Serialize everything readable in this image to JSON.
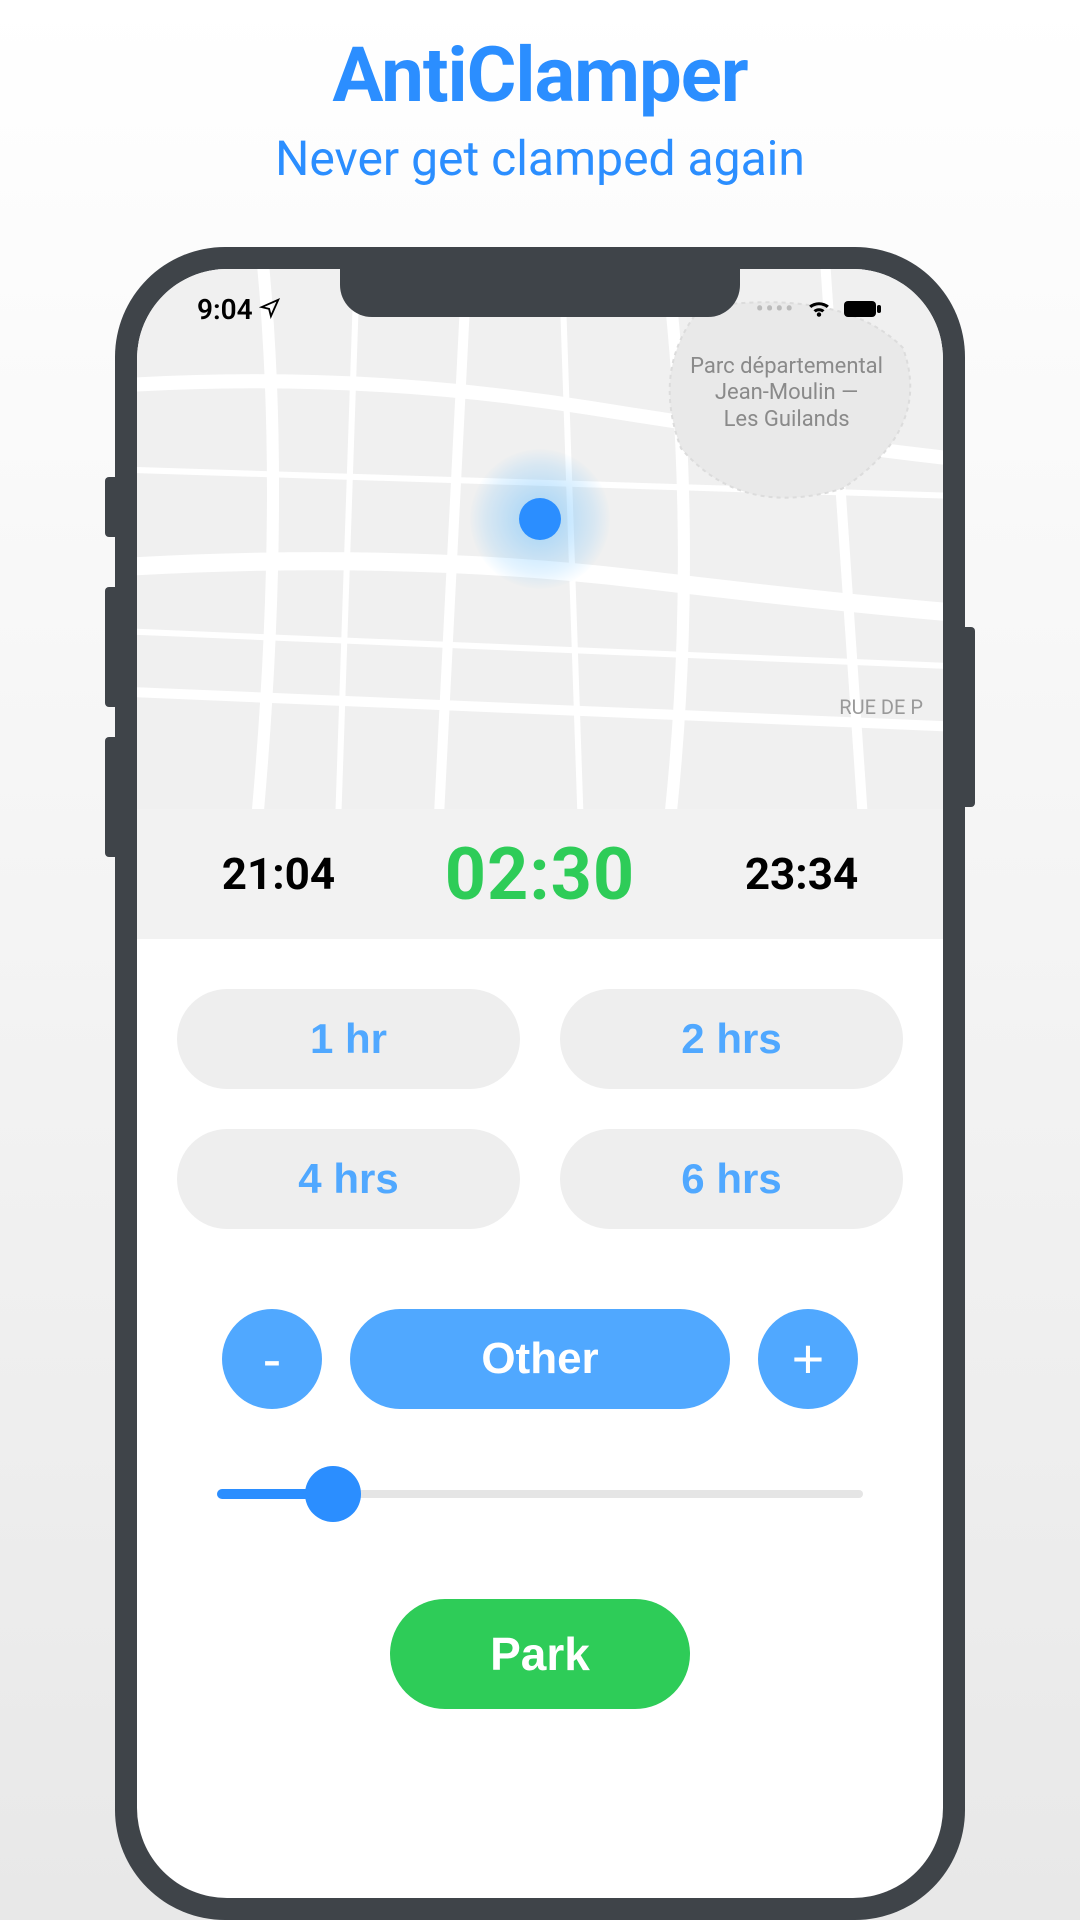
{
  "header": {
    "title": "AntiClamper",
    "subtitle": "Never get clamped again"
  },
  "status": {
    "time": "9:04",
    "location_icon": "location-arrow-icon",
    "wifi_icon": "wifi-icon",
    "battery_icon": "battery-icon"
  },
  "map": {
    "park_name_line1": "Parc départemental",
    "park_name_line2": "Jean-Moulin —",
    "park_name_line3": "Les Guilands",
    "street_label": "RUE DE P"
  },
  "timer": {
    "start_time": "21:04",
    "duration": "02:30",
    "end_time": "23:34"
  },
  "presets": [
    {
      "label": "1 hr"
    },
    {
      "label": "2 hrs"
    },
    {
      "label": "4 hrs"
    },
    {
      "label": "6 hrs"
    }
  ],
  "other": {
    "minus": "-",
    "label": "Other",
    "plus": "+"
  },
  "slider": {
    "percent": 18
  },
  "park_button": "Park",
  "colors": {
    "accent_blue": "#2b8eff",
    "light_blue": "#50a8ff",
    "green": "#2ecc58",
    "grey_btn": "#eeeeee"
  }
}
